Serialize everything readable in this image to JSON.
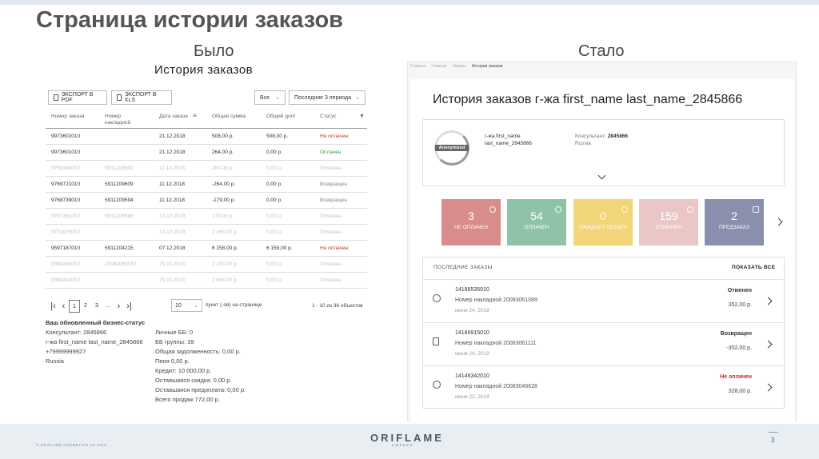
{
  "slide": {
    "title": "Страница истории заказов",
    "before_label": "Было",
    "after_label": "Стало",
    "copyright": "© ORIFLAME COSMETICS AG 2018",
    "logo": "ORIFLAME",
    "logo_sub": "SWEDEN",
    "page_number": "3"
  },
  "old": {
    "title": "История заказов",
    "export_pdf": "ЭКСПОРТ В PDF",
    "export_xls": "ЭКСПОРТ В XLS",
    "filter_all": "Все",
    "filter_period": "Последние 3 периода",
    "columns": [
      "Номер заказа",
      "Номер накладной",
      "Дата заказа",
      "Общая сумма",
      "Общий долг",
      "Статус"
    ],
    "rows": [
      {
        "order": "9973602010",
        "invoice": "",
        "date": "21.12.2018",
        "total": "508,00 р.",
        "debt": "508,00 р.",
        "status": "Не оплачен",
        "status_class": "red",
        "dim": false
      },
      {
        "order": "9973601010",
        "invoice": "",
        "date": "21.12.2018",
        "total": "264,00 р.",
        "debt": "0,00 р.",
        "status": "Оплачен",
        "status_class": "green",
        "dim": false
      },
      {
        "order": "9769340010",
        "invoice": "5911209602",
        "date": "11.12.2018",
        "total": "264,00 р.",
        "debt": "0,00 р.",
        "status": "Отменен",
        "status_class": "gray",
        "dim": true
      },
      {
        "order": "9769721010",
        "invoice": "5911209609",
        "date": "11.12.2018",
        "total": "-264,00 р.",
        "debt": "0,00 р.",
        "status": "Возвращен",
        "status_class": "gray",
        "dim": false
      },
      {
        "order": "9768739010",
        "invoice": "5911209594",
        "date": "11.12.2018",
        "total": "-179,00 р.",
        "debt": "0,00 р.",
        "status": "Возвращен",
        "status_class": "gray",
        "dim": false
      },
      {
        "order": "9767361010",
        "invoice": "5911209588",
        "date": "10.12.2018",
        "total": "179,00 р.",
        "debt": "0,00 р.",
        "status": "Отменен",
        "status_class": "gray",
        "dim": true
      },
      {
        "order": "9731675010",
        "invoice": "",
        "date": "10.12.2018",
        "total": "2 368,00 р.",
        "debt": "0,00 р.",
        "status": "Отменен",
        "status_class": "gray",
        "dim": true
      },
      {
        "order": "9597187010",
        "invoice": "5911204215",
        "date": "07.12.2018",
        "total": "6 158,00 р.",
        "debt": "6 158,00 р.",
        "status": "Не оплачен",
        "status_class": "red",
        "dim": false
      },
      {
        "order": "9368363010",
        "invoice": "20083063057",
        "date": "29.11.2018",
        "total": "2 193,00 р.",
        "debt": "0,00 р.",
        "status": "Отменен",
        "status_class": "gray",
        "dim": true
      },
      {
        "order": "9368324010",
        "invoice": "",
        "date": "29.11.2018",
        "total": "2 694,00 р.",
        "debt": "0,00 р.",
        "status": "Отменен",
        "status_class": "gray",
        "dim": true
      }
    ],
    "pagination": {
      "pages": [
        "1",
        "2",
        "3",
        "..."
      ],
      "per_page": "10",
      "per_page_label": "пункт (-ов) на странице",
      "range": "1 - 10 из 36 объектов"
    },
    "status_block": {
      "heading": "Ваш обновленный бизнес-статус",
      "consultant": "Консультант: 2845866",
      "name": "г-жа first_name last_name_2845866",
      "phone": "+79999999927",
      "country": "Russia"
    },
    "stats": [
      "Личные ББ: 0",
      "ББ группы: 39",
      "Общая задолженность: 0,00 р.",
      "Пеня 0,00 р.",
      "Кредит: 10 000,00 р.",
      "Оставшаяся скидка: 0,00 р.",
      "Оставшаяся предоплата: 0,00 р.",
      "Всего продаж 772,00 р."
    ]
  },
  "new": {
    "breadcrumbs": [
      "Главная",
      "Главная",
      "Заказы",
      "История заказов"
    ],
    "title": "История заказов г-жа first_name last_name_2845866",
    "avatar_label": "Anonymized",
    "profile": {
      "name_line1": "г-жа first_name",
      "name_line2": "last_name_2845866",
      "consultant_label": "Консультант:",
      "consultant_id": "2845866",
      "country": "Russia"
    },
    "stats": [
      {
        "num": "3",
        "label": "НЕ ОПЛАЧЕН",
        "color": "#d98c8c",
        "icon": "info-icon"
      },
      {
        "num": "54",
        "label": "ОПЛАЧЕН",
        "color": "#8fc3a7",
        "icon": "check-icon"
      },
      {
        "num": "0",
        "label": "ОЖИДАЕТ ОПЛАТУ",
        "color": "#f1d578",
        "icon": "clock-icon"
      },
      {
        "num": "159",
        "label": "ОТМЕНЕН",
        "color": "#ebc6c6",
        "icon": "cancel-icon"
      },
      {
        "num": "2",
        "label": "ПРЕДЗАКАЗ",
        "color": "#8b8fae",
        "icon": "calendar-icon"
      }
    ],
    "recent": {
      "heading": "ПОСЛЕДНИЕ ЗАКАЗЫ",
      "show_all": "ПОКАЗАТЬ ВСЕ",
      "orders": [
        {
          "id": "14186535010",
          "invoice": "Номер накладной 20083061089",
          "date": "июня 24, 2019",
          "status": "Отменен",
          "amount": "352,00 р.",
          "red": false,
          "icon": "cancel-icon"
        },
        {
          "id": "14186915010",
          "invoice": "Номер накладной 20083061111",
          "date": "июня 24, 2019",
          "status": "Возвращен",
          "amount": "-352,00 р.",
          "red": false,
          "icon": "document-icon"
        },
        {
          "id": "14146342010",
          "invoice": "Номер накладной 20083046628",
          "date": "июня 22, 2019",
          "status": "Не оплачен",
          "amount": "328,00 р.",
          "red": true,
          "icon": "info-icon"
        }
      ]
    }
  }
}
